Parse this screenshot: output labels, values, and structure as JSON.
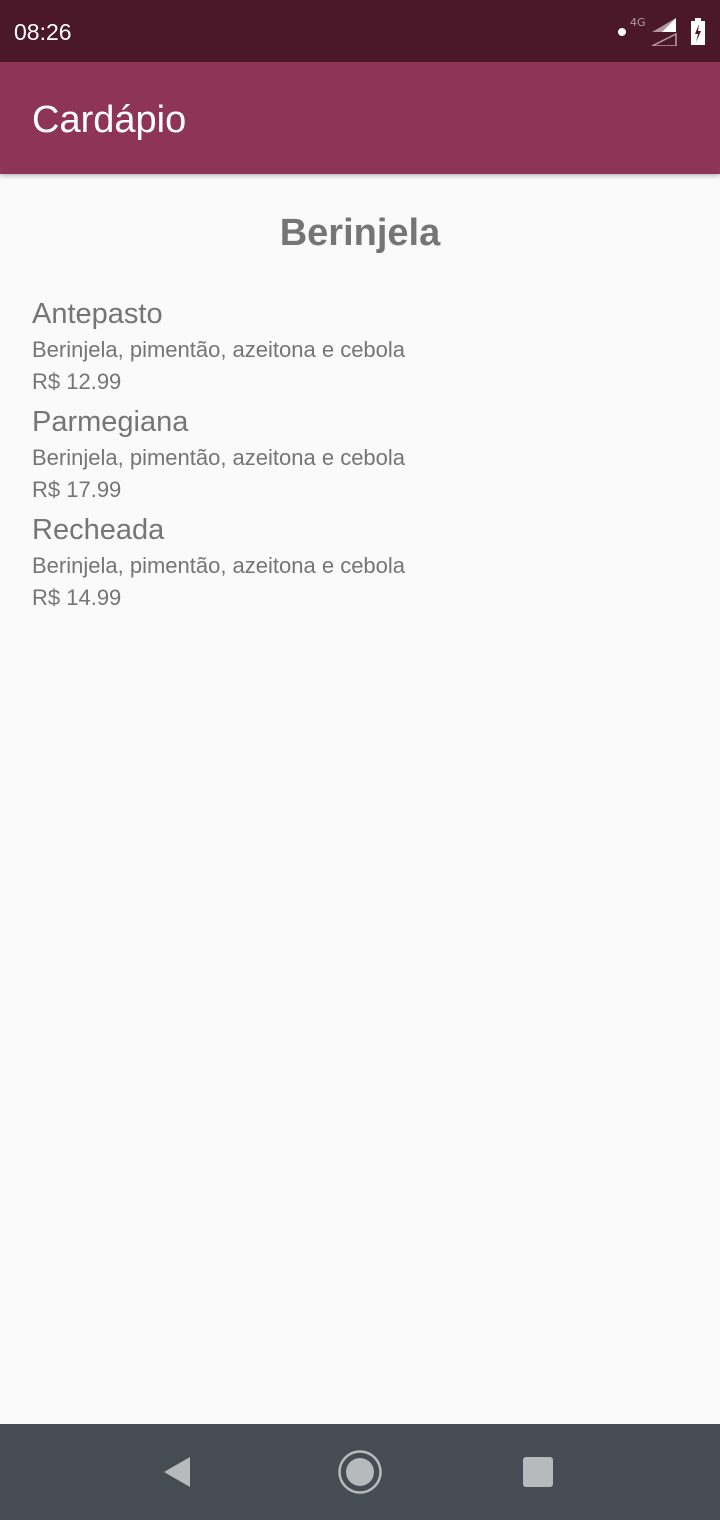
{
  "status_bar": {
    "time": "08:26",
    "network": "4G",
    "icons": [
      "notification-dot",
      "signal-icon",
      "battery-icon"
    ]
  },
  "app_bar": {
    "title": "Cardápio",
    "color": "#8e3457"
  },
  "section": {
    "title": "Berinjela"
  },
  "menu_items": [
    {
      "name": "Antepasto",
      "description": "Berinjela, pimentão, azeitona e cebola",
      "price": "R$ 12.99"
    },
    {
      "name": "Parmegiana",
      "description": "Berinjela, pimentão, azeitona e cebola",
      "price": "R$ 17.99"
    },
    {
      "name": "Recheada",
      "description": "Berinjela, pimentão, azeitona e cebola",
      "price": "R$ 14.99"
    }
  ],
  "nav_bar": {
    "icons": [
      "back-icon",
      "home-icon",
      "recents-icon"
    ]
  }
}
